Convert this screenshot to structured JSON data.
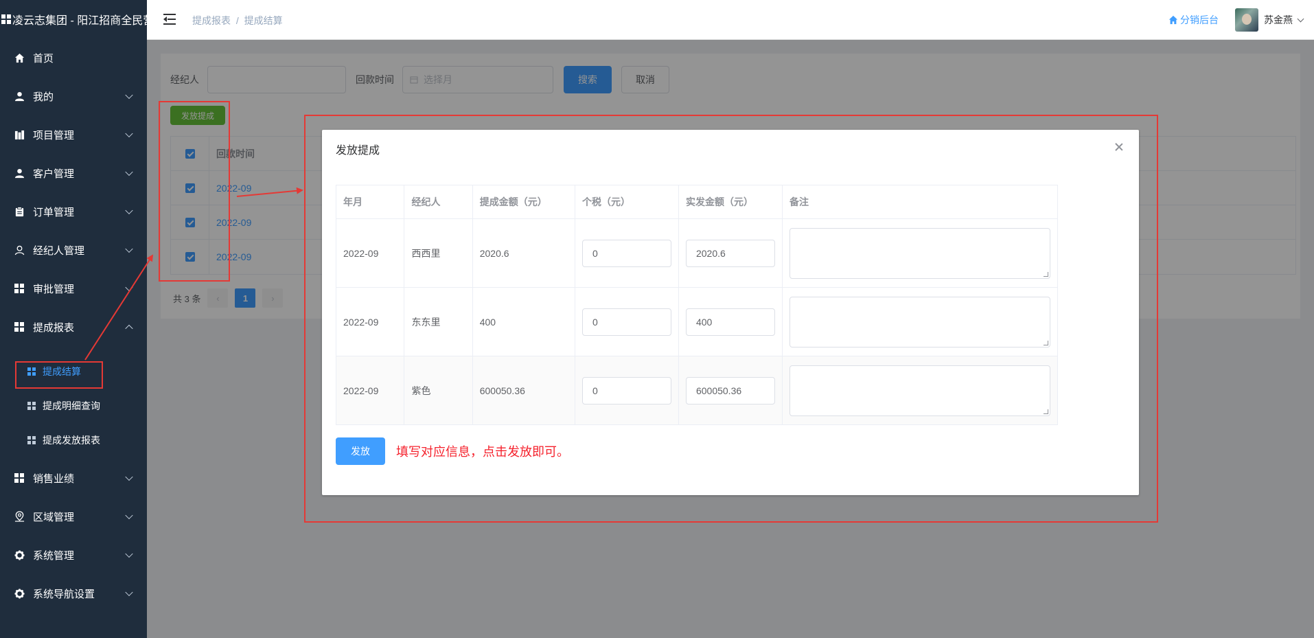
{
  "brand": {
    "title": "凌云志集团 - 阳江招商全民营销"
  },
  "sidebar": {
    "items": [
      {
        "label": "首页",
        "icon": "home-icon",
        "chevron": ""
      },
      {
        "label": "我的",
        "icon": "user-icon",
        "chevron": "down"
      },
      {
        "label": "项目管理",
        "icon": "building-icon",
        "chevron": "down"
      },
      {
        "label": "客户管理",
        "icon": "user-icon",
        "chevron": "down"
      },
      {
        "label": "订单管理",
        "icon": "clipboard-icon",
        "chevron": "down"
      },
      {
        "label": "经纪人管理",
        "icon": "user-outline-icon",
        "chevron": "down"
      },
      {
        "label": "审批管理",
        "icon": "grid-icon",
        "chevron": "down"
      },
      {
        "label": "提成报表",
        "icon": "grid-icon",
        "chevron": "up"
      }
    ],
    "subitems": [
      {
        "label": "提成结算",
        "active": true
      },
      {
        "label": "提成明细查询",
        "active": false
      },
      {
        "label": "提成发放报表",
        "active": false
      }
    ],
    "items_after": [
      {
        "label": "销售业绩",
        "icon": "grid-icon"
      },
      {
        "label": "区域管理",
        "icon": "location-icon"
      },
      {
        "label": "系统管理",
        "icon": "gear-icon"
      },
      {
        "label": "系统导航设置",
        "icon": "gear-icon"
      }
    ]
  },
  "header": {
    "breadcrumb_parent": "提成报表",
    "breadcrumb_sep": "/",
    "breadcrumb_current": "提成结算",
    "dist_link": "分销后台",
    "user_name": "苏金燕"
  },
  "search": {
    "agent_label": "经纪人",
    "agent_value": "",
    "time_label": "回款时间",
    "time_placeholder": "选择月",
    "search_button": "搜索",
    "cancel_button": "取消",
    "issue_button": "发放提成"
  },
  "bg_table": {
    "header": "回款时间",
    "rows": [
      "2022-09",
      "2022-09",
      "2022-09"
    ]
  },
  "pager": {
    "total": "共 3 条",
    "page": "1"
  },
  "dialog": {
    "title": "发放提成",
    "columns": [
      "年月",
      "经纪人",
      "提成金额（元）",
      "个税（元）",
      "实发金额（元）",
      "备注"
    ],
    "rows": [
      {
        "month": "2022-09",
        "agent": "西西里",
        "amount": "2020.6",
        "tax": "0",
        "net": "2020.6",
        "note": ""
      },
      {
        "month": "2022-09",
        "agent": "东东里",
        "amount": "400",
        "tax": "0",
        "net": "400",
        "note": ""
      },
      {
        "month": "2022-09",
        "agent": "紫色",
        "amount": "600050.36",
        "tax": "0",
        "net": "600050.36",
        "note": ""
      }
    ],
    "submit": "发放",
    "hint": "填写对应信息，点击发放即可。"
  },
  "colors": {
    "sidebar_bg": "#1f2d3d",
    "primary": "#409eff",
    "success": "#67c23a",
    "annotation": "#e53935"
  }
}
